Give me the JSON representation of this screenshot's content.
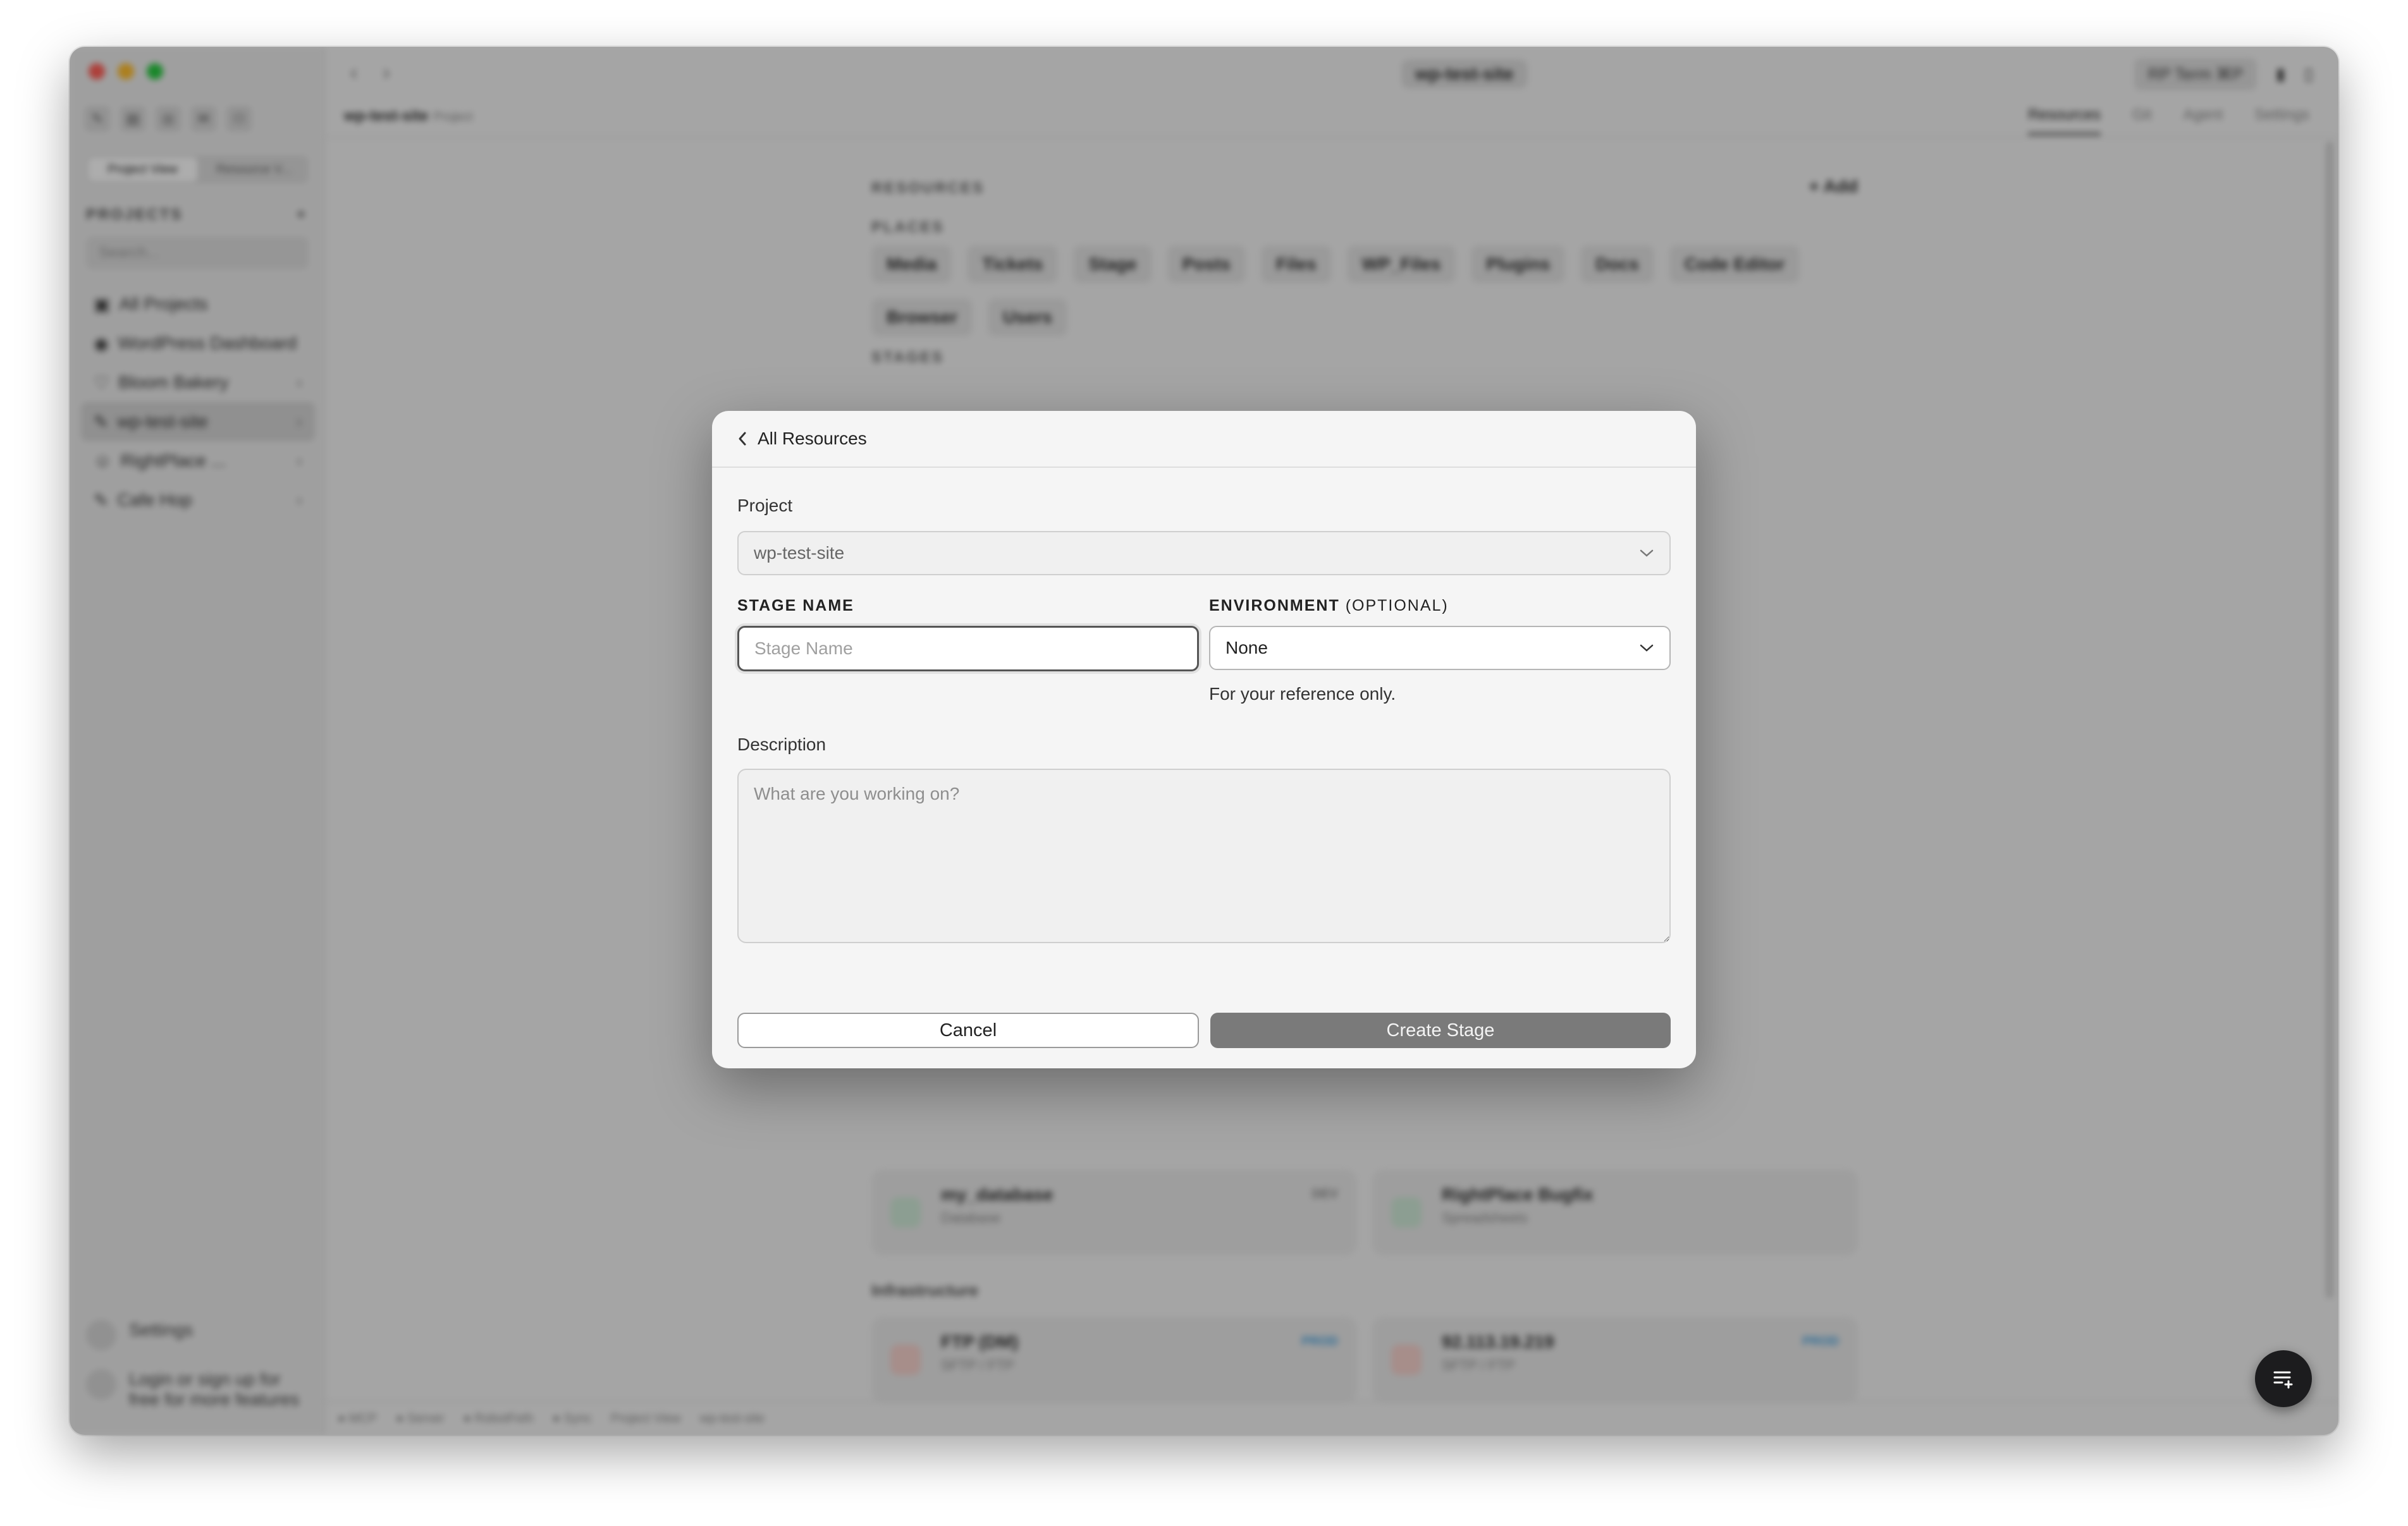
{
  "app": {
    "title": "wp-test-site",
    "breadcrumb_name": "wp-test-site",
    "breadcrumb_type": "Project",
    "terminal_label": "RP Term",
    "terminal_shortcut": "⌘P"
  },
  "sidebar": {
    "view_tabs": [
      "Project View",
      "Resource V..."
    ],
    "projects_heading": "PROJECTS",
    "search_placeholder": "Search...",
    "items": [
      {
        "label": "All Projects"
      },
      {
        "label": "WordPress Dashboard"
      },
      {
        "label": "Bloom Bakery"
      },
      {
        "label": "wp-test-site"
      },
      {
        "label": "RightPlace ..."
      },
      {
        "label": "Cafe Hop"
      }
    ],
    "settings_label": "Settings",
    "login_label": "Login or sign up for free for more features"
  },
  "tabs": [
    "Resources",
    "Git",
    "Agent",
    "Settings"
  ],
  "resources": {
    "heading": "RESOURCES",
    "add_label": "+ Add",
    "places_heading": "PLACES",
    "places": [
      "Media",
      "Tickets",
      "Stage",
      "Posts",
      "Files",
      "WP_Files",
      "Plugins",
      "Docs",
      "Code Editor",
      "Browser",
      "Users"
    ],
    "stages_heading": "STAGES",
    "cards": [
      {
        "title": "my_database",
        "subtitle": "Database",
        "tag": "DEV"
      },
      {
        "title": "RightPlace Bugfix",
        "subtitle": "Spreadsheets",
        "tag": ""
      }
    ],
    "infra_heading": "Infrastructure",
    "infra_cards": [
      {
        "title": "FTP (DM)",
        "subtitle": "SFTP / FTP",
        "tag": "PROD"
      },
      {
        "title": "92.113.19.219",
        "subtitle": "SFTP / FTP",
        "tag": "PROD"
      }
    ]
  },
  "statusbar": [
    "● MCP",
    "● Server",
    "● RobotFeth",
    "● Sync",
    "Project View",
    "wp-test-site"
  ],
  "modal": {
    "back_label": "All Resources",
    "project_label": "Project",
    "project_value": "wp-test-site",
    "stage_name_label": "STAGE NAME",
    "stage_name_placeholder": "Stage Name",
    "stage_name_value": "",
    "environment_label": "ENVIRONMENT",
    "environment_optional": "(OPTIONAL)",
    "environment_value": "None",
    "environment_hint": "For your reference only.",
    "description_label": "Description",
    "description_placeholder": "What are you working on?",
    "cancel_label": "Cancel",
    "create_label": "Create Stage"
  }
}
